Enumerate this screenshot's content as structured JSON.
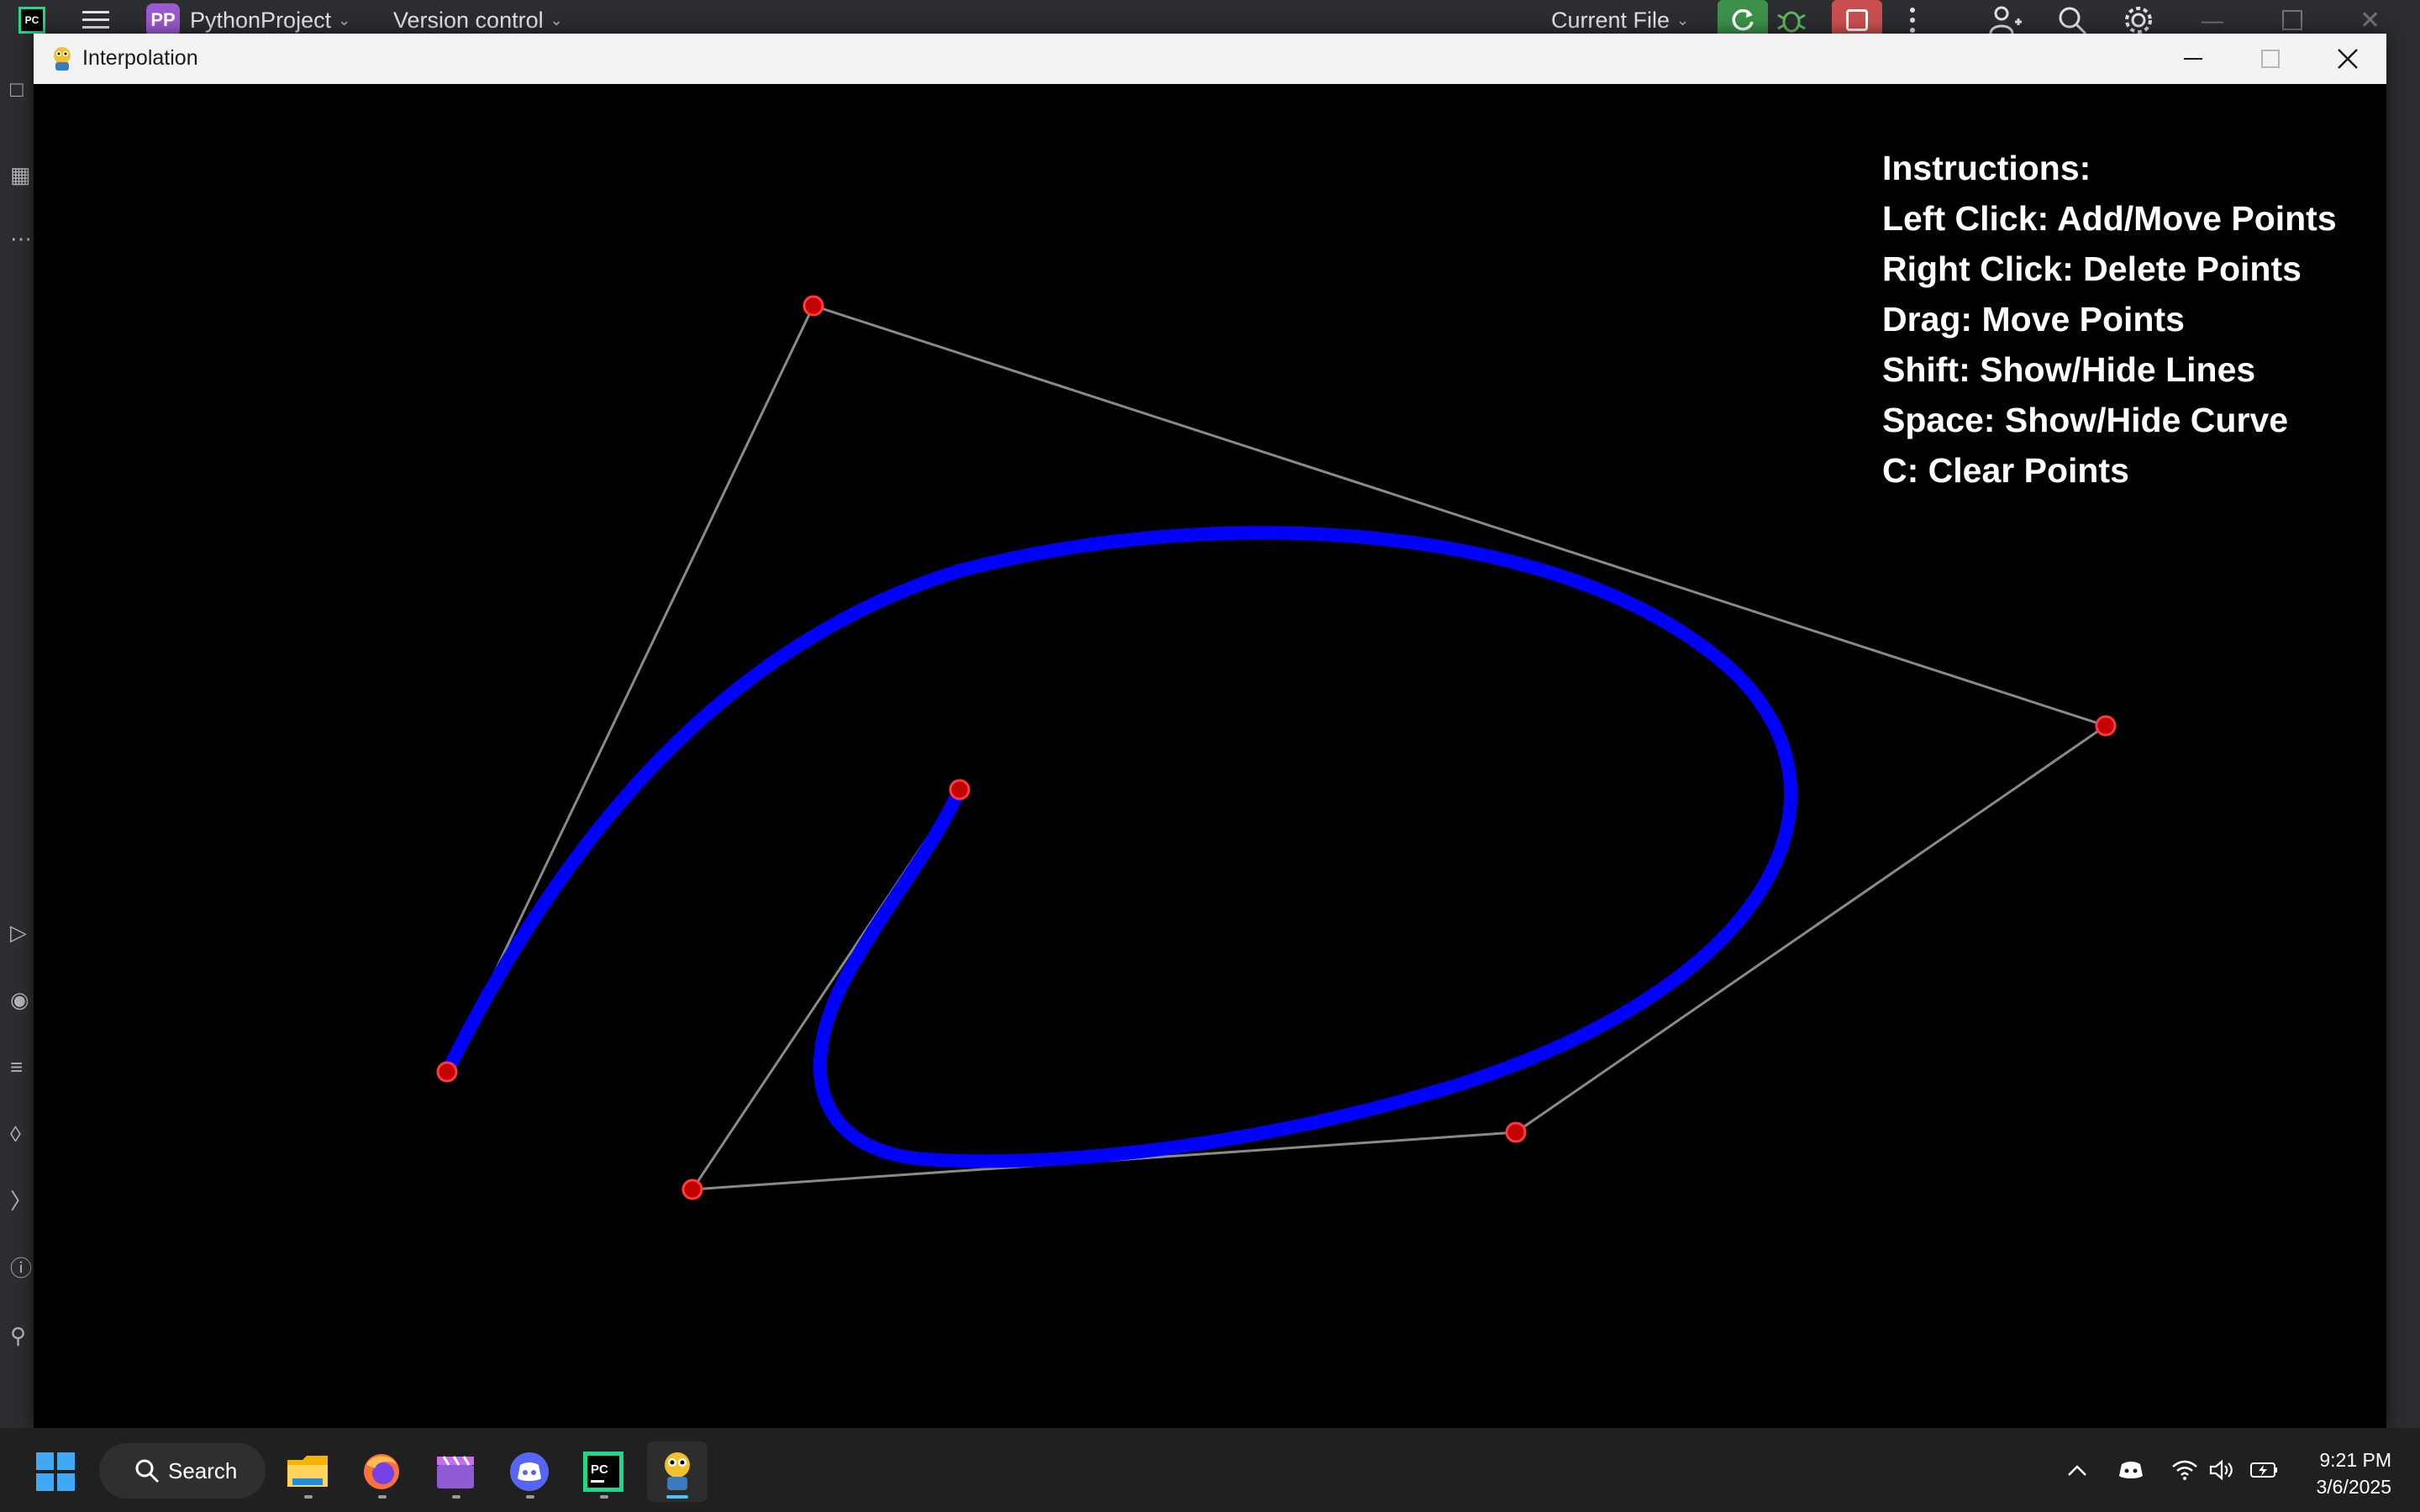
{
  "ide": {
    "logo_text": "PC",
    "project_badge": "PP",
    "project_name": "PythonProject",
    "version_control": "Version control",
    "run_config": "Current File"
  },
  "window": {
    "title": "Interpolation"
  },
  "instructions": [
    "Instructions:",
    "Left Click: Add/Move Points",
    "Right Click: Delete Points",
    "Drag: Move Points",
    "Shift: Show/Hide Lines",
    "Space: Show/Hide Curve",
    "C: Clear Points"
  ],
  "scene": {
    "background": "#000000",
    "curve_color": "#0000ff",
    "line_color": "#808080",
    "point_color": "#ff0000"
  },
  "taskbar": {
    "search_label": "Search",
    "time": "9:21 PM",
    "date": "3/6/2025",
    "apps": [
      "start-icon",
      "file-explorer-icon",
      "firefox-icon",
      "clapper-icon",
      "discord-icon",
      "pycharm-icon",
      "pygame-icon"
    ]
  }
}
